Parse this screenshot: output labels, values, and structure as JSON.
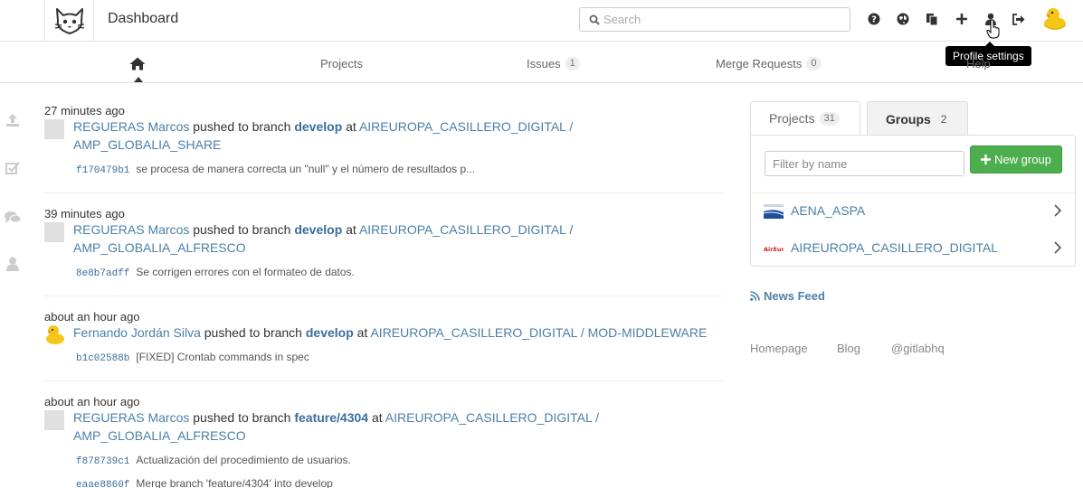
{
  "header": {
    "title": "Dashboard",
    "search_placeholder": "Search",
    "tooltip": "Profile settings"
  },
  "nav": {
    "projects": "Projects",
    "issues": "Issues",
    "issues_count": "1",
    "merge_requests": "Merge Requests",
    "merge_requests_count": "0",
    "help": "Help"
  },
  "events": [
    {
      "time": "27 minutes ago",
      "author": "REGUERAS Marcos",
      "action": "pushed to branch",
      "branch": "develop",
      "at": "at",
      "project_line1": "AIREUROPA_CASILLERO_DIGITAL /",
      "project_line2": "AMP_GLOBALIA_SHARE",
      "commits": [
        {
          "sha": "f170479b1",
          "message": "se procesa de manera correcta un \"null\" y el número de resultados p..."
        }
      ]
    },
    {
      "time": "39 minutes ago",
      "author": "REGUERAS Marcos",
      "action": "pushed to branch",
      "branch": "develop",
      "at": "at",
      "project_line1": "AIREUROPA_CASILLERO_DIGITAL /",
      "project_line2": "AMP_GLOBALIA_ALFRESCO",
      "commits": [
        {
          "sha": "8e8b7adff",
          "message": "Se corrigen errores con el formateo de datos."
        }
      ]
    },
    {
      "time": "about an hour ago",
      "author": "Fernando Jordán Silva",
      "action": "pushed to branch",
      "branch": "develop",
      "at": "at",
      "project_line1": "AIREUROPA_CASILLERO_DIGITAL / MOD-MIDDLEWARE",
      "commits": [
        {
          "sha": "b1c02588b",
          "message": "[FIXED] Crontab commands in spec"
        }
      ]
    },
    {
      "time": "about an hour ago",
      "author": "REGUERAS Marcos",
      "action": "pushed to branch",
      "branch": "feature/4304",
      "at": "at",
      "project_line1": "AIREUROPA_CASILLERO_DIGITAL /",
      "project_line2": "AMP_GLOBALIA_ALFRESCO",
      "commits": [
        {
          "sha": "f878739c1",
          "message": "Actualización del procedimiento de usuarios."
        },
        {
          "sha": "eaae8860f",
          "message": "Merge branch 'feature/4304' into develop"
        }
      ]
    }
  ],
  "sidebar_panel": {
    "tab_projects": "Projects",
    "tab_projects_count": "31",
    "tab_groups": "Groups",
    "tab_groups_count": "2",
    "filter_placeholder": "Filter by name",
    "new_group": "New group",
    "groups": [
      {
        "name": "AENA_ASPA"
      },
      {
        "name": "AIREUROPA_CASILLERO_DIGITAL"
      }
    ],
    "news_feed": "News Feed"
  },
  "footer": {
    "homepage": "Homepage",
    "blog": "Blog",
    "twitter": "@gitlabhq"
  },
  "colors": {
    "link": "#4a7fa8",
    "branch": "#3a6e9c",
    "success": "#4cae4c"
  }
}
